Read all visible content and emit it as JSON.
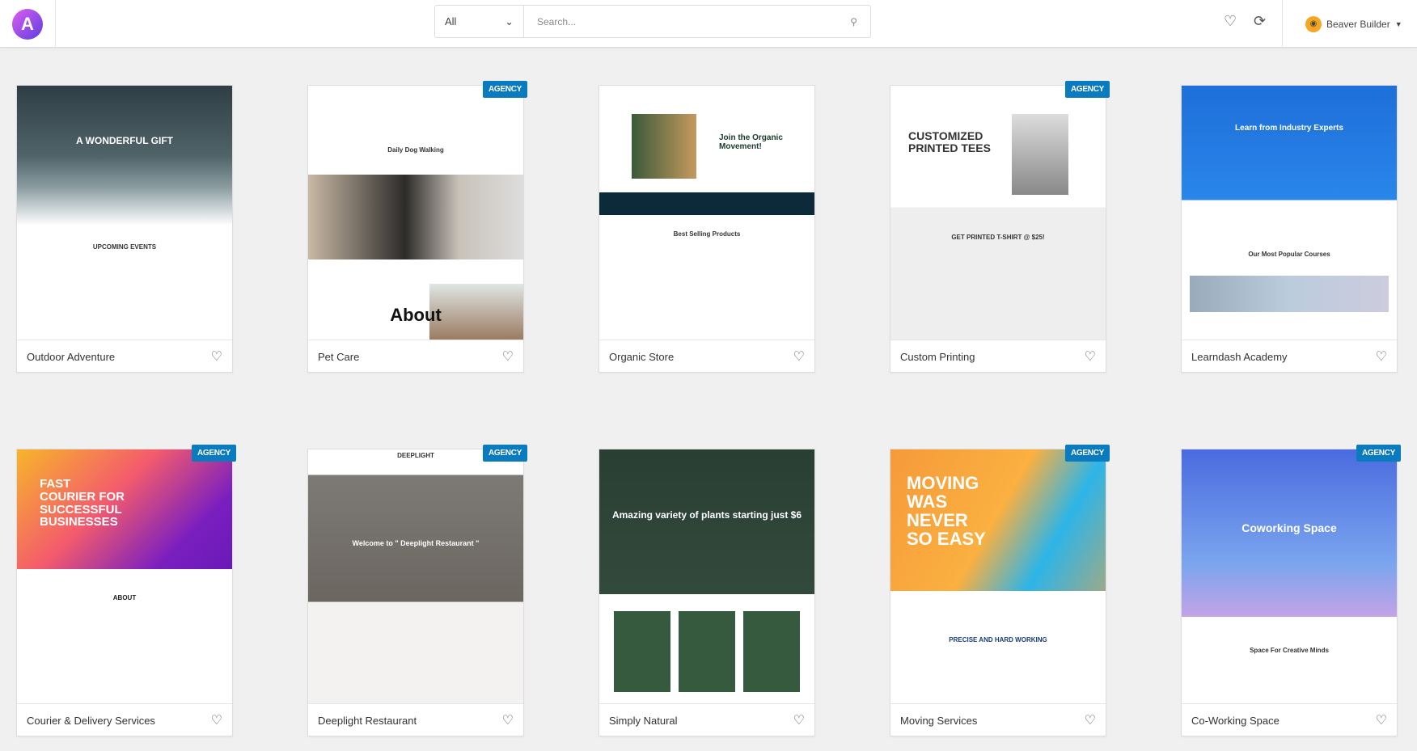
{
  "header": {
    "logo_letter": "A",
    "filter_value": "All",
    "search_placeholder": "Search...",
    "user_name": "Beaver Builder",
    "icons": [
      "heart-icon",
      "refresh-icon",
      "search-icon",
      "chevron-down-icon"
    ]
  },
  "badge_label": "AGENCY",
  "colors": {
    "badge": "#0b7bc0",
    "accent": "#5a3fe0"
  },
  "templates": [
    {
      "name": "Outdoor Adventure",
      "agency": false,
      "headline": "A WONDERFUL GIFT",
      "sub": "UPCOMING EVENTS"
    },
    {
      "name": "Pet Care",
      "agency": true,
      "headline": "About",
      "sub": "Daily Dog Walking"
    },
    {
      "name": "Organic Store",
      "agency": false,
      "headline": "Join the Organic Movement!",
      "sub": "Best Selling Products"
    },
    {
      "name": "Custom Printing",
      "agency": true,
      "headline": "CUSTOMIZED PRINTED TEES",
      "sub": "GET PRINTED T-SHIRT @ $25!"
    },
    {
      "name": "Learndash Academy",
      "agency": false,
      "headline": "Learn from Industry Experts",
      "sub": "Our Most Popular Courses"
    },
    {
      "name": "Courier & Delivery Services",
      "agency": true,
      "headline": "FAST COURIER FOR SUCCESSFUL BUSINESSES",
      "sub": "ABOUT"
    },
    {
      "name": "Deeplight Restaurant",
      "agency": true,
      "headline": "Welcome to \" Deeplight Restaurant \"",
      "sub": "DEEPLIGHT"
    },
    {
      "name": "Simply Natural",
      "agency": false,
      "headline": "Amazing variety of plants starting just $6",
      "sub": ""
    },
    {
      "name": "Moving Services",
      "agency": true,
      "headline": "MOVING WAS NEVER SO EASY",
      "sub": "PRECISE AND HARD WORKING"
    },
    {
      "name": "Co-Working Space",
      "agency": true,
      "headline": "Coworking Space",
      "sub": "Space For Creative Minds"
    }
  ]
}
